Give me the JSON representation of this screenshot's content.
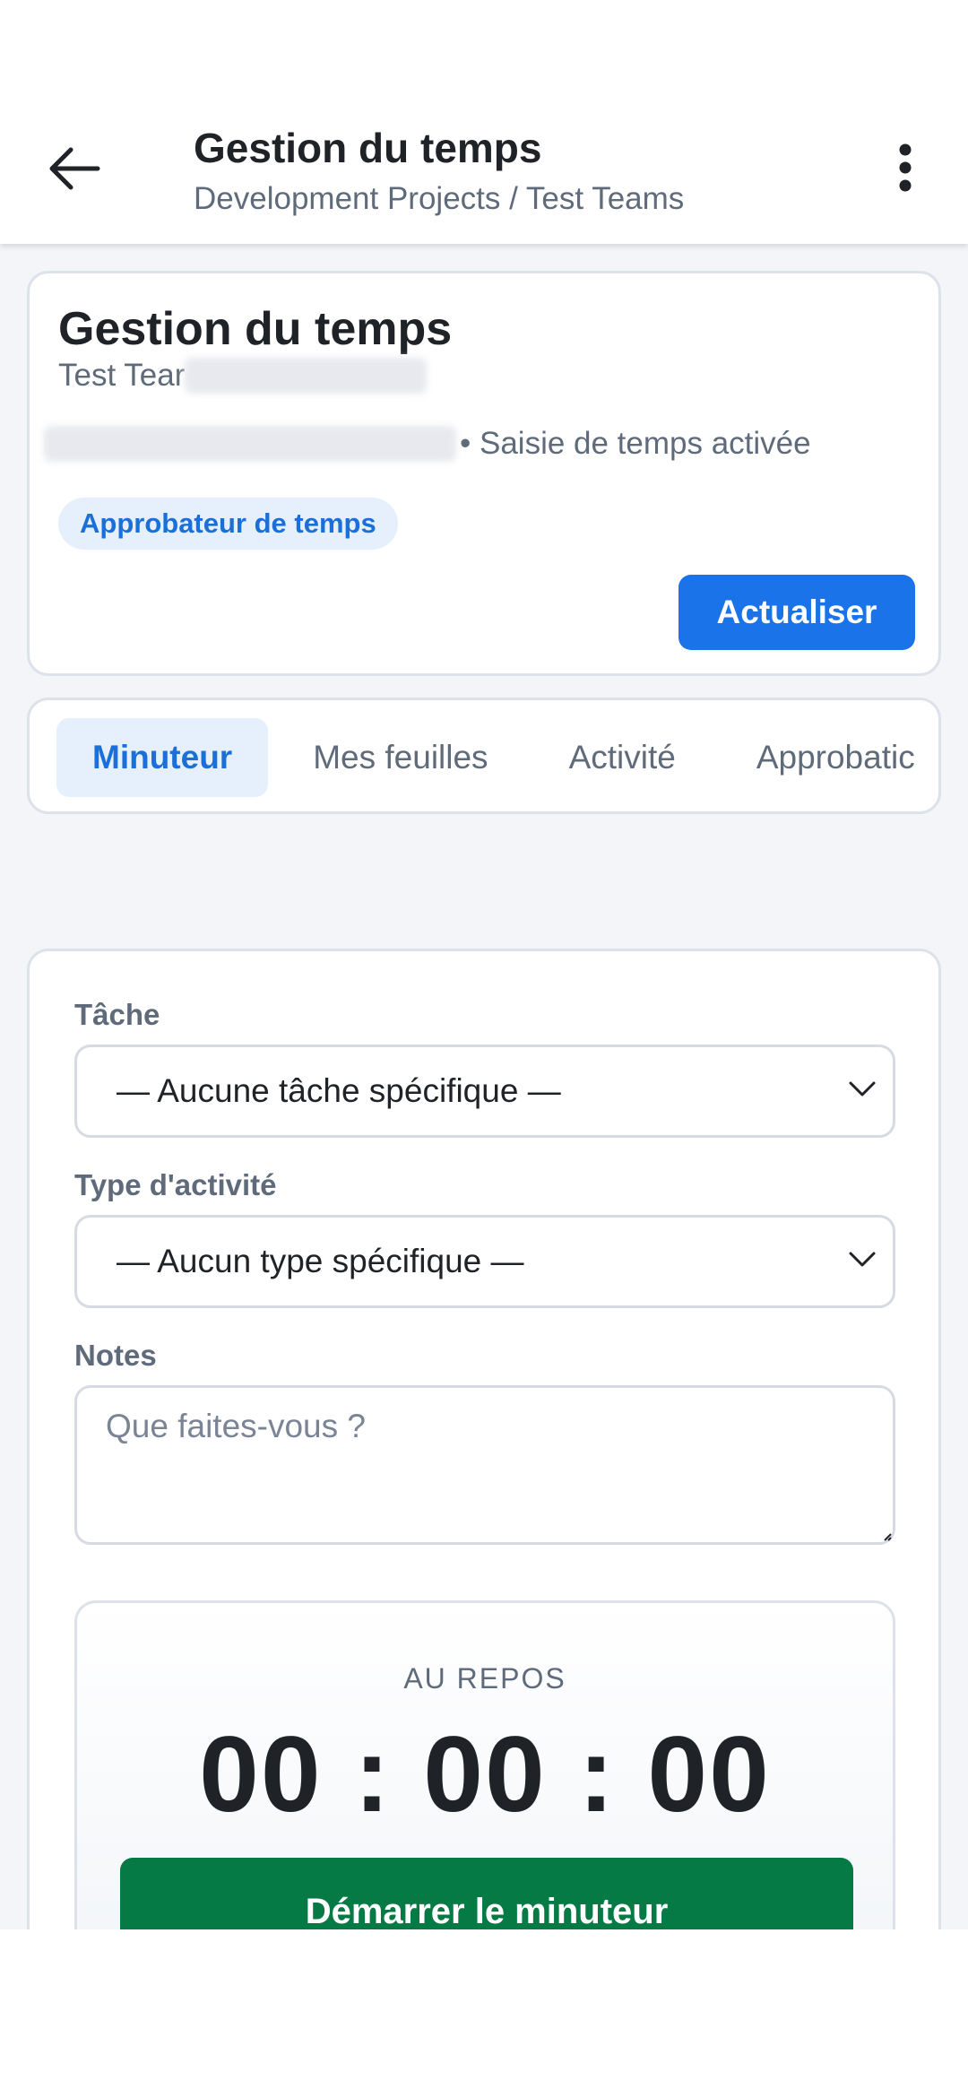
{
  "appbar": {
    "title": "Gestion du temps",
    "subtitle": "Development Projects / Test Teams",
    "back_icon": "arrow-left-icon",
    "more_icon": "more-vertical-icon"
  },
  "header_card": {
    "title": "Gestion du temps",
    "team_prefix": "Test Tear",
    "meta_status": "• Saisie de temps activée",
    "role_badge": "Approbateur de temps",
    "refresh_label": "Actualiser"
  },
  "tabs": [
    {
      "label": "Minuteur",
      "active": true
    },
    {
      "label": "Mes feuilles",
      "active": false
    },
    {
      "label": "Activité",
      "active": false
    },
    {
      "label": "Approbatic",
      "active": false
    }
  ],
  "form": {
    "task_label": "Tâche",
    "task_value": "— Aucune tâche spécifique —",
    "activity_label": "Type d'activité",
    "activity_value": "— Aucun type spécifique —",
    "notes_label": "Notes",
    "notes_placeholder": "Que faites-vous ?"
  },
  "timer": {
    "status": "AU REPOS",
    "display": "00 : 00 : 00",
    "start_label": "Démarrer le minuteur"
  },
  "colors": {
    "primary": "#1a73e8",
    "success": "#067a45",
    "badge_bg": "#e6f0fc",
    "muted_text": "#5f6b7a"
  }
}
